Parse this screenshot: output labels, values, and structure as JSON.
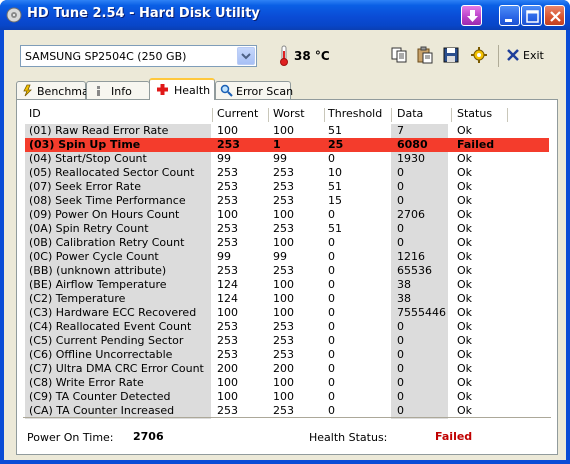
{
  "window": {
    "title": "HD Tune 2.54 - Hard Disk Utility"
  },
  "toolbar": {
    "drive": "SAMSUNG SP2504C (250 GB)",
    "temperature": "38 °C",
    "exit_label": "Exit",
    "icons": [
      "copy-icon",
      "paste-icon",
      "save-icon",
      "options-icon",
      "exit-icon"
    ]
  },
  "tabs": [
    {
      "label": "Benchmark",
      "icon": "benchmark-icon"
    },
    {
      "label": "Info",
      "icon": "info-icon"
    },
    {
      "label": "Health",
      "icon": "health-icon",
      "active": true
    },
    {
      "label": "Error Scan",
      "icon": "error-scan-icon"
    }
  ],
  "table": {
    "columns": [
      "ID",
      "Current",
      "Worst",
      "Threshold",
      "Data",
      "Status"
    ],
    "rows": [
      {
        "id": "(01) Raw Read Error Rate",
        "current": "100",
        "worst": "100",
        "threshold": "51",
        "data": "7",
        "status": "Ok"
      },
      {
        "id": "(03) Spin Up Time",
        "current": "253",
        "worst": "1",
        "threshold": "25",
        "data": "6080",
        "status": "Failed",
        "failed": true
      },
      {
        "id": "(04) Start/Stop Count",
        "current": "99",
        "worst": "99",
        "threshold": "0",
        "data": "1930",
        "status": "Ok"
      },
      {
        "id": "(05) Reallocated Sector Count",
        "current": "253",
        "worst": "253",
        "threshold": "10",
        "data": "0",
        "status": "Ok"
      },
      {
        "id": "(07) Seek Error Rate",
        "current": "253",
        "worst": "253",
        "threshold": "51",
        "data": "0",
        "status": "Ok"
      },
      {
        "id": "(08) Seek Time Performance",
        "current": "253",
        "worst": "253",
        "threshold": "15",
        "data": "0",
        "status": "Ok"
      },
      {
        "id": "(09) Power On Hours Count",
        "current": "100",
        "worst": "100",
        "threshold": "0",
        "data": "2706",
        "status": "Ok"
      },
      {
        "id": "(0A) Spin Retry Count",
        "current": "253",
        "worst": "253",
        "threshold": "51",
        "data": "0",
        "status": "Ok"
      },
      {
        "id": "(0B) Calibration Retry Count",
        "current": "253",
        "worst": "100",
        "threshold": "0",
        "data": "0",
        "status": "Ok"
      },
      {
        "id": "(0C) Power Cycle Count",
        "current": "99",
        "worst": "99",
        "threshold": "0",
        "data": "1216",
        "status": "Ok"
      },
      {
        "id": "(BB) (unknown attribute)",
        "current": "253",
        "worst": "253",
        "threshold": "0",
        "data": "65536",
        "status": "Ok"
      },
      {
        "id": "(BE) Airflow Temperature",
        "current": "124",
        "worst": "100",
        "threshold": "0",
        "data": "38",
        "status": "Ok"
      },
      {
        "id": "(C2) Temperature",
        "current": "124",
        "worst": "100",
        "threshold": "0",
        "data": "38",
        "status": "Ok"
      },
      {
        "id": "(C3) Hardware ECC Recovered",
        "current": "100",
        "worst": "100",
        "threshold": "0",
        "data": "7555446",
        "status": "Ok"
      },
      {
        "id": "(C4) Reallocated Event Count",
        "current": "253",
        "worst": "253",
        "threshold": "0",
        "data": "0",
        "status": "Ok"
      },
      {
        "id": "(C5) Current Pending Sector",
        "current": "253",
        "worst": "253",
        "threshold": "0",
        "data": "0",
        "status": "Ok"
      },
      {
        "id": "(C6) Offline Uncorrectable",
        "current": "253",
        "worst": "253",
        "threshold": "0",
        "data": "0",
        "status": "Ok"
      },
      {
        "id": "(C7) Ultra DMA CRC Error Count",
        "current": "200",
        "worst": "200",
        "threshold": "0",
        "data": "0",
        "status": "Ok"
      },
      {
        "id": "(C8) Write Error Rate",
        "current": "100",
        "worst": "100",
        "threshold": "0",
        "data": "0",
        "status": "Ok"
      },
      {
        "id": "(C9) TA Counter Detected",
        "current": "100",
        "worst": "100",
        "threshold": "0",
        "data": "0",
        "status": "Ok"
      },
      {
        "id": "(CA) TA Counter Increased",
        "current": "253",
        "worst": "253",
        "threshold": "0",
        "data": "0",
        "status": "Ok"
      }
    ]
  },
  "footer": {
    "power_on_label": "Power On Time:",
    "power_on_value": "2706",
    "health_label": "Health Status:",
    "health_value": "Failed"
  },
  "colors": {
    "failed_row": "#F43C2C",
    "failed_text": "#C00000",
    "titlebar": "#0A4CD6"
  }
}
